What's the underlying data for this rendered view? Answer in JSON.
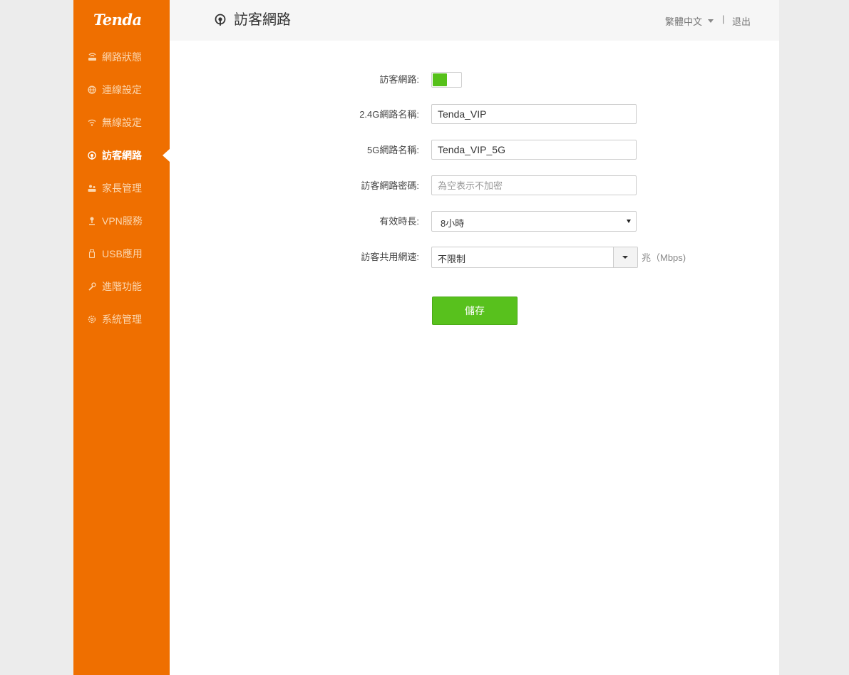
{
  "brand": {
    "logo_text": "Tenda"
  },
  "sidebar": {
    "items": [
      {
        "label": "網路狀態",
        "icon": "router-icon",
        "active": false
      },
      {
        "label": "連線設定",
        "icon": "globe-icon",
        "active": false
      },
      {
        "label": "無線設定",
        "icon": "wifi-icon",
        "active": false
      },
      {
        "label": "訪客網路",
        "icon": "guest-network-icon",
        "active": true
      },
      {
        "label": "家長管理",
        "icon": "parental-control-icon",
        "active": false
      },
      {
        "label": "VPN服務",
        "icon": "vpn-icon",
        "active": false
      },
      {
        "label": "USB應用",
        "icon": "usb-icon",
        "active": false
      },
      {
        "label": "進階功能",
        "icon": "wrench-icon",
        "active": false
      },
      {
        "label": "系統管理",
        "icon": "gear-icon",
        "active": false
      }
    ]
  },
  "header": {
    "title": "訪客網路",
    "language": "繁體中文",
    "separator": "|",
    "logout": "退出"
  },
  "form": {
    "guest_network": {
      "label": "訪客網路:",
      "enabled": true
    },
    "ssid_24g": {
      "label": "2.4G網路名稱:",
      "value": "Tenda_VIP"
    },
    "ssid_5g": {
      "label": "5G網路名稱:",
      "value": "Tenda_VIP_5G"
    },
    "password": {
      "label": "訪客網路密碼:",
      "value": "",
      "placeholder": "為空表示不加密"
    },
    "duration": {
      "label": "有效時長:",
      "value": "8小時"
    },
    "shared_speed": {
      "label": "訪客共用網速:",
      "value": "不限制",
      "unit": "兆（Mbps)"
    },
    "save_label": "儲存"
  },
  "colors": {
    "sidebar": "#ef6f00",
    "accent_green": "#56c11a"
  }
}
